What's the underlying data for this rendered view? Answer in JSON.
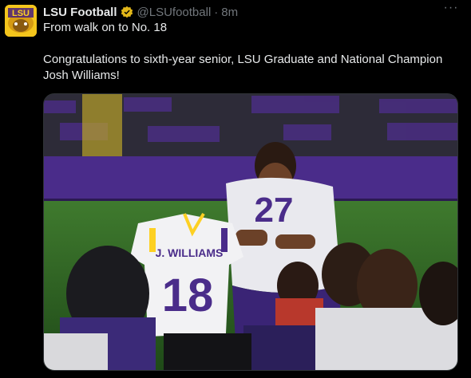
{
  "tweet": {
    "display_name": "LSU Football",
    "handle": "@LSUfootball",
    "separator": "·",
    "time": "8m",
    "line1": "From walk on to No. 18",
    "line2": "Congratulations to sixth-year senior, LSU Graduate and National Champion Josh Williams!",
    "more_label": "···"
  },
  "avatar": {
    "logo_text": "LSU"
  },
  "media": {
    "jersey_name": "J. WILLIAMS",
    "jersey_number": "18",
    "practice_number": "27"
  },
  "colors": {
    "background": "#000000",
    "text": "#e7e9ea",
    "muted": "#71767b",
    "verified_gold": "#e2b719",
    "lsu_purple": "#461d7c",
    "lsu_gold": "#fdd023"
  },
  "icons": {
    "verified": "verified-badge-icon",
    "more": "more-options-icon"
  }
}
